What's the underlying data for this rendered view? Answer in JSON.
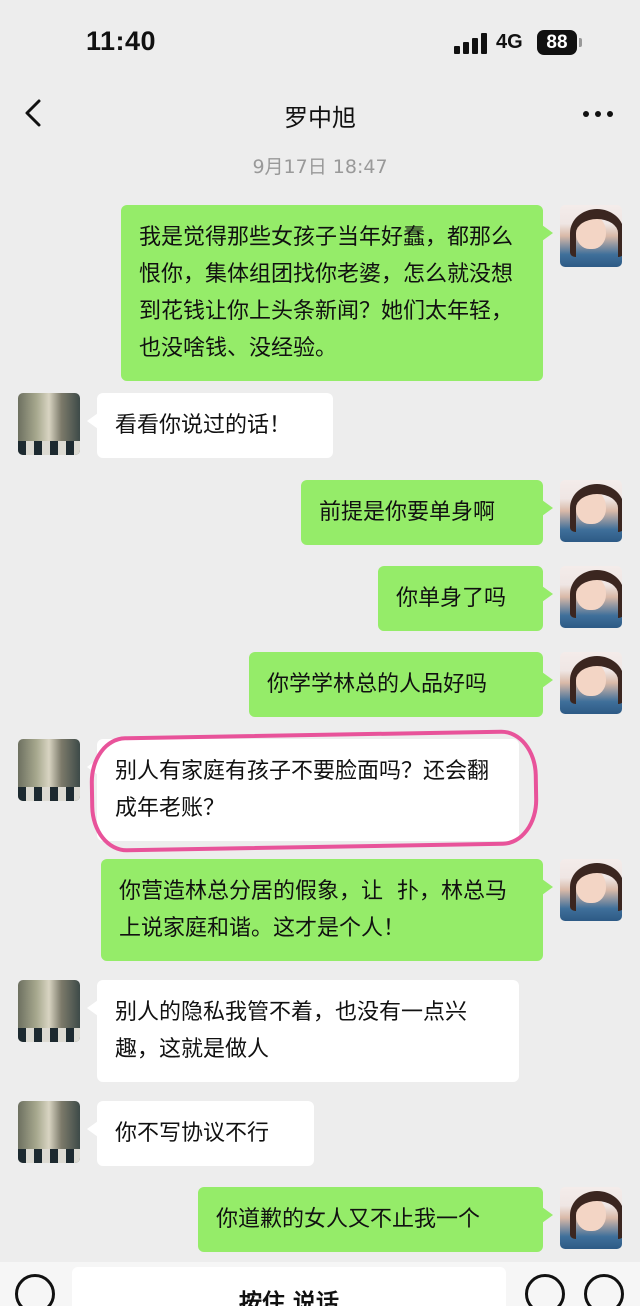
{
  "status": {
    "time": "11:40",
    "network": "4G",
    "battery": "88"
  },
  "nav": {
    "title": "罗中旭"
  },
  "timestamp": "9月17日 18:47",
  "messages": [
    {
      "from": "me",
      "text": "我是觉得那些女孩子当年好蠢，都那么恨你，集体组团找你老婆，怎么就没想到花钱让你上头条新闻？她们太年轻，也没啥钱、没经验。"
    },
    {
      "from": "other",
      "text": "看看你说过的话！"
    },
    {
      "from": "me",
      "text": "前提是你要单身啊"
    },
    {
      "from": "me",
      "text": "你单身了吗"
    },
    {
      "from": "me",
      "text": "你学学林总的人品好吗"
    },
    {
      "from": "other",
      "text": "别人有家庭有孩子不要脸面吗？还会翻成年老账？"
    },
    {
      "from": "me",
      "text": "你营造林总分居的假象，让  扑，林总马上说家庭和谐。这才是个人！"
    },
    {
      "from": "other",
      "text": "别人的隐私我管不着，也没有一点兴趣，这就是做人"
    },
    {
      "from": "other",
      "text": "你不写协议不行"
    },
    {
      "from": "me",
      "text": "你道歉的女人又不止我一个"
    }
  ],
  "input": {
    "voice_label": "按住 说话"
  },
  "icons": {
    "back": "chevron-left-icon",
    "more": "more-dots-icon",
    "keyboard": "keyboard-icon",
    "emoji": "emoji-icon",
    "plus": "plus-icon"
  }
}
